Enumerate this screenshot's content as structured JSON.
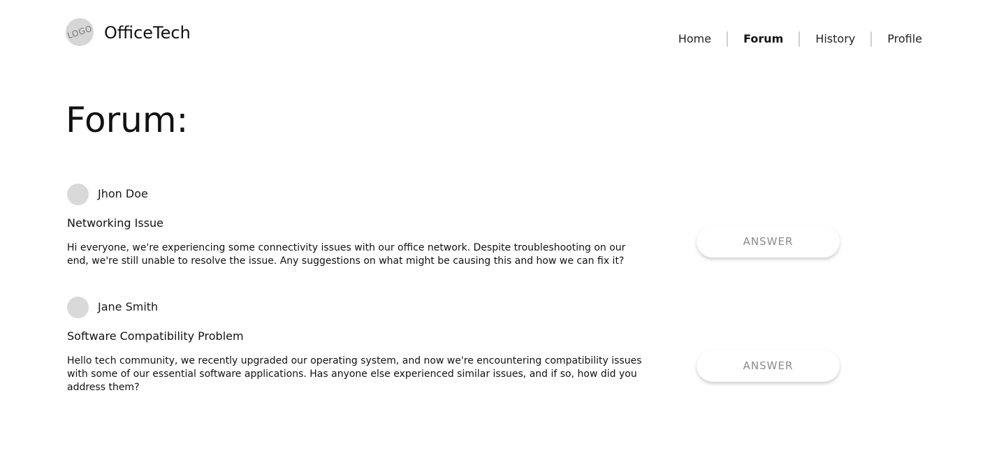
{
  "header": {
    "logo_text": "LOGO",
    "brand": "OfficeTech",
    "nav": [
      {
        "label": "Home",
        "active": false
      },
      {
        "label": "Forum",
        "active": true
      },
      {
        "label": "History",
        "active": false
      },
      {
        "label": "Profile",
        "active": false
      }
    ]
  },
  "page": {
    "title": "Forum:"
  },
  "posts": [
    {
      "author": "Jhon Doe",
      "title": "Networking Issue",
      "body": "Hi everyone, we're experiencing some connectivity issues with our office network. Despite troubleshooting on our end, we're still unable to resolve the issue. Any suggestions on what might be causing this and how we can fix it?",
      "answer_label": "ANSWER"
    },
    {
      "author": "Jane Smith",
      "title": "Software Compatibility Problem",
      "body": "Hello tech community, we recently upgraded our operating system, and now we're encountering compatibility issues with some of our essential software applications. Has anyone else experienced similar issues, and if so, how did you address them?",
      "answer_label": "ANSWER"
    }
  ],
  "colors": {
    "avatar": "#d9d9d9",
    "logo": "#d6d6d6",
    "nav_separator": "#cfcfcf",
    "button_text": "#8a8a8a"
  }
}
